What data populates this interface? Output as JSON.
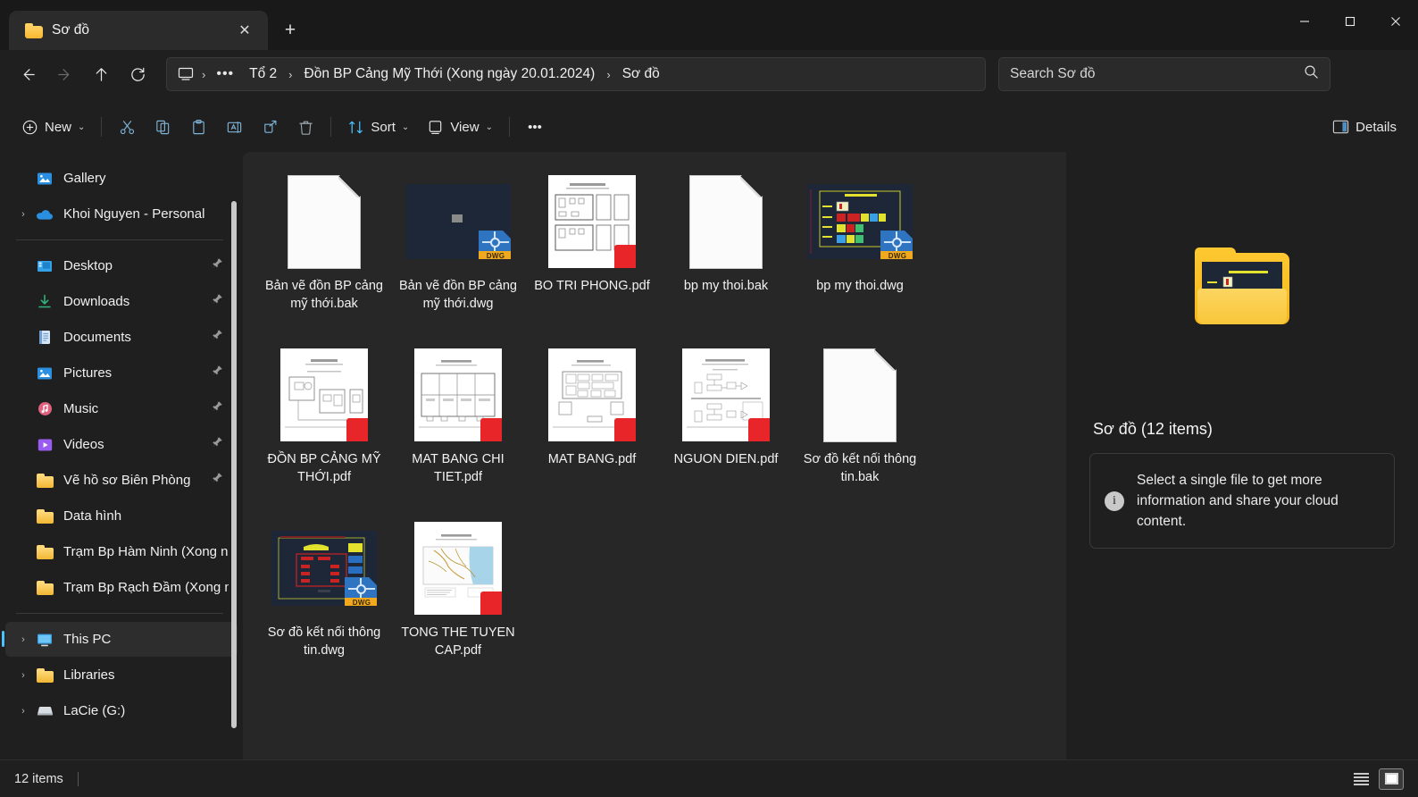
{
  "window": {
    "tab_title": "Sơ đồ",
    "tab_close_glyph": "✕",
    "new_tab_glyph": "+",
    "minimize_glyph": "—",
    "maximize_glyph": "▢",
    "close_glyph": "✕"
  },
  "nav": {
    "back_glyph": "←",
    "forward_glyph": "→",
    "up_glyph": "↑",
    "refresh_glyph": "⟳",
    "breadcrumb": [
      {
        "label": "Tổ 2"
      },
      {
        "label": "Đồn BP Cảng Mỹ Thới (Xong ngày 20.01.2024)"
      },
      {
        "label": "Sơ đồ"
      }
    ],
    "breadcrumb_ellipsis": "•••",
    "separator": "›"
  },
  "search": {
    "placeholder": "Search Sơ đồ"
  },
  "toolbar": {
    "new_label": "New",
    "sort_label": "Sort",
    "view_label": "View",
    "details_label": "Details",
    "overflow_glyph": "•••",
    "chevron": "⌄",
    "icons": [
      "cut-icon",
      "copy-icon",
      "paste-icon",
      "rename-icon",
      "share-icon",
      "delete-icon"
    ]
  },
  "sidebar": {
    "items": [
      {
        "label": "Gallery",
        "icon": "gallery-icon",
        "expandable": false,
        "pinned": false,
        "selected": false
      },
      {
        "label": "Khoi Nguyen - Personal",
        "icon": "onedrive-icon",
        "expandable": true,
        "pinned": false,
        "selected": false
      },
      {
        "separator": true
      },
      {
        "label": "Desktop",
        "icon": "desktop-icon",
        "expandable": false,
        "pinned": true,
        "selected": false
      },
      {
        "label": "Downloads",
        "icon": "downloads-icon",
        "expandable": false,
        "pinned": true,
        "selected": false
      },
      {
        "label": "Documents",
        "icon": "documents-icon",
        "expandable": false,
        "pinned": true,
        "selected": false
      },
      {
        "label": "Pictures",
        "icon": "pictures-icon",
        "expandable": false,
        "pinned": true,
        "selected": false
      },
      {
        "label": "Music",
        "icon": "music-icon",
        "expandable": false,
        "pinned": true,
        "selected": false
      },
      {
        "label": "Videos",
        "icon": "videos-icon",
        "expandable": false,
        "pinned": true,
        "selected": false
      },
      {
        "label": "Vẽ hồ sơ Biên Phòng",
        "icon": "folder-icon",
        "expandable": false,
        "pinned": true,
        "selected": false
      },
      {
        "label": "Data hình",
        "icon": "folder-icon",
        "expandable": false,
        "pinned": false,
        "selected": false
      },
      {
        "label": "Trạm Bp Hàm Ninh (Xong ng",
        "icon": "folder-icon",
        "expandable": false,
        "pinned": false,
        "selected": false
      },
      {
        "label": "Trạm Bp Rạch Đầm (Xong n",
        "icon": "folder-icon",
        "expandable": false,
        "pinned": false,
        "selected": false
      },
      {
        "separator": true
      },
      {
        "label": "This PC",
        "icon": "this-pc-icon",
        "expandable": true,
        "pinned": false,
        "selected": true
      },
      {
        "label": "Libraries",
        "icon": "folder-icon",
        "expandable": true,
        "pinned": false,
        "selected": false
      },
      {
        "label": "LaCie (G:)",
        "icon": "drive-icon",
        "expandable": true,
        "pinned": false,
        "selected": false
      }
    ],
    "expand_glyph": "›",
    "pin_glyph": "📌"
  },
  "files": [
    {
      "name": "Bản vẽ đồn BP cảng mỹ thới.bak",
      "thumb": "blank-document"
    },
    {
      "name": "Bản vẽ đồn BP cảng mỹ thới.dwg",
      "thumb": "dwg-dark"
    },
    {
      "name": "BO TRI PHONG.pdf",
      "thumb": "pdf-plan"
    },
    {
      "name": "bp my thoi.bak",
      "thumb": "blank-document"
    },
    {
      "name": "bp my thoi.dwg",
      "thumb": "dwg-colored"
    },
    {
      "name": "ĐỒN BP CẢNG MỸ THỚI.pdf",
      "thumb": "pdf-diagram"
    },
    {
      "name": "MAT BANG CHI TIET.pdf",
      "thumb": "pdf-plan"
    },
    {
      "name": "MAT BANG.pdf",
      "thumb": "pdf-blocks"
    },
    {
      "name": "NGUON DIEN.pdf",
      "thumb": "pdf-flow"
    },
    {
      "name": "Sơ đồ kết nối thông tin.bak",
      "thumb": "blank-document"
    },
    {
      "name": "Sơ đồ kết nối thông tin.dwg",
      "thumb": "dwg-red"
    },
    {
      "name": "TONG THE TUYEN CAP.pdf",
      "thumb": "pdf-map"
    }
  ],
  "details_pane": {
    "title": "Sơ đồ (12 items)",
    "info_glyph": "i",
    "message": "Select a single file to get more information and share your cloud content."
  },
  "statusbar": {
    "items_count": "12 items",
    "list_view_name": "list-view",
    "grid_view_name": "grid-view"
  },
  "colors": {
    "accent": "#4cc2ff",
    "pdf_red": "#e8262a",
    "folder_yellow": "#f5b71c",
    "window_bg": "#1f1f1f",
    "content_bg": "#272727"
  }
}
